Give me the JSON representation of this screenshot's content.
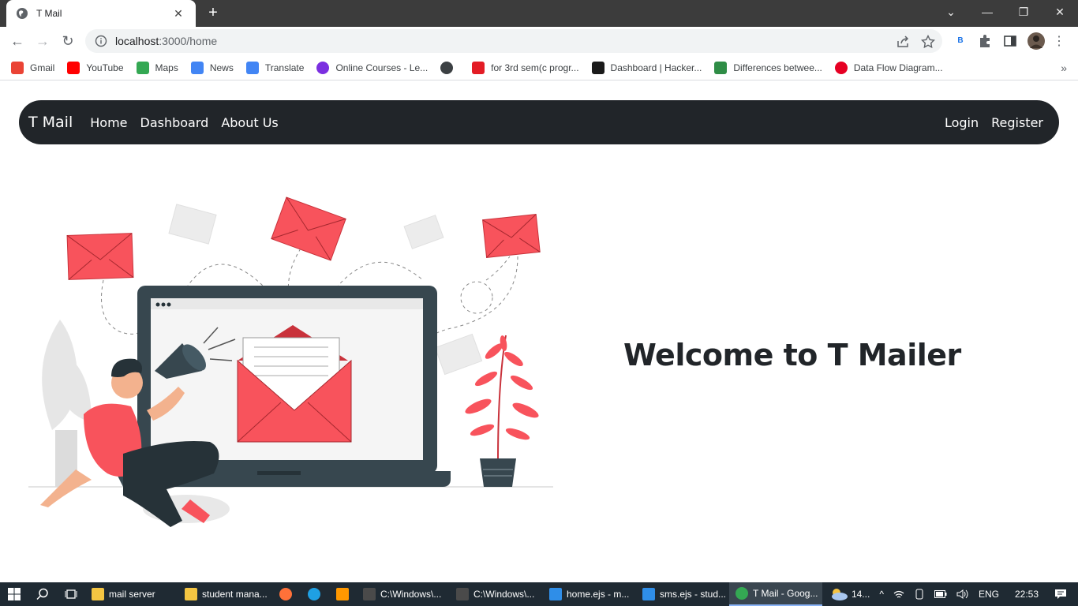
{
  "browser": {
    "tab": {
      "title": "T Mail",
      "close": "✕"
    },
    "new_tab": "+",
    "window_controls": {
      "dropdown": "⌄",
      "minimize": "—",
      "restore": "❐",
      "close": "✕"
    },
    "nav": {
      "back": "←",
      "forward": "→",
      "reload": "↻"
    },
    "url": {
      "host": "localhost",
      "path": ":3000/home"
    },
    "profile_badge": "B",
    "bookmarks": [
      {
        "label": "Gmail",
        "icon": "gmail-icon",
        "color": "#ea4335"
      },
      {
        "label": "YouTube",
        "icon": "youtube-icon",
        "color": "#ff0000"
      },
      {
        "label": "Maps",
        "icon": "maps-icon",
        "color": "#34a853"
      },
      {
        "label": "News",
        "icon": "news-icon",
        "color": "#4285f4"
      },
      {
        "label": "Translate",
        "icon": "translate-icon",
        "color": "#4285f4"
      },
      {
        "label": "Online Courses - Le...",
        "icon": "courses-icon",
        "color": "#7b2fe0"
      },
      {
        "label": "",
        "icon": "globe-icon",
        "color": "#3c4043"
      },
      {
        "label": "for 3rd sem(c progr...",
        "icon": "bookmark-v-icon",
        "color": "#e31c25"
      },
      {
        "label": "Dashboard | Hacker...",
        "icon": "hackerrank-icon",
        "color": "#1a1a1a"
      },
      {
        "label": "Differences betwee...",
        "icon": "gfg-icon",
        "color": "#2f8d46"
      },
      {
        "label": "Data Flow Diagram...",
        "icon": "pinterest-icon",
        "color": "#e60023"
      }
    ],
    "bookmarks_more": "»"
  },
  "site": {
    "brand": "T Mail",
    "nav_left": [
      "Home",
      "Dashboard",
      "About Us"
    ],
    "nav_right": [
      "Login",
      "Register"
    ],
    "welcome": "Welcome to T Mailer",
    "accent": "#f8535c",
    "nav_bg": "#212529"
  },
  "taskbar": {
    "apps": [
      {
        "label": "mail server",
        "icon": "folder-icon"
      },
      {
        "label": "student mana...",
        "icon": "folder-icon"
      },
      {
        "label": "",
        "icon": "firefox-icon"
      },
      {
        "label": "",
        "icon": "edge-icon"
      },
      {
        "label": "",
        "icon": "sublime-icon"
      },
      {
        "label": "C:\\Windows\\...",
        "icon": "cmd-icon"
      },
      {
        "label": "C:\\Windows\\...",
        "icon": "cmd-icon"
      },
      {
        "label": "home.ejs - m...",
        "icon": "vscode-icon"
      },
      {
        "label": "sms.ejs - stud...",
        "icon": "vscode-icon"
      },
      {
        "label": "T Mail - Goog...",
        "icon": "chrome-icon",
        "active": true
      }
    ],
    "weather": "14...",
    "language": "ENG",
    "time": "22:53"
  }
}
